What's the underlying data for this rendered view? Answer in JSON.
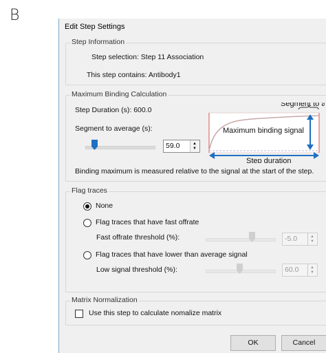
{
  "panel_letter": "B",
  "dialog": {
    "title": "Edit Step Settings",
    "step_info": {
      "legend": "Step Information",
      "selection": "Step selection: Step 11 Association",
      "contains": "This step contains: Antibody1"
    },
    "max_binding": {
      "legend": "Maximum Binding Calculation",
      "duration": "Step Duration (s): 600.0",
      "segment_label": "Segment to average (s):",
      "segment_value": "59.0",
      "segment_slider_fraction": 0.1,
      "note": "Binding maximum is measured relative to the signal at the start of the step.",
      "diagram": {
        "segment_to_average": "Segment to average",
        "max_binding_signal": "Maximum binding signal",
        "step_duration": "Step duration"
      }
    },
    "flag_traces": {
      "legend": "Flag traces",
      "none_label": "None",
      "fast_offrate_label": "Flag traces that have fast offrate",
      "fast_offrate_threshold_label": "Fast offrate threshold (%):",
      "fast_offrate_value": "-5.0",
      "low_signal_label": "Flag traces that have lower than average signal",
      "low_signal_threshold_label": "Low signal threshold (%):",
      "low_signal_value": "60.0",
      "selected": "None"
    },
    "matrix": {
      "legend": "Matrix Normalization",
      "checkbox_label": "Use this step to calculate nomalize matrix",
      "checked": false
    },
    "ok_label": "OK",
    "cancel_label": "Cancel"
  },
  "colors": {
    "accent_blue": "#1f6fc4",
    "signal_red": "#e05050",
    "curve": "#c8a8a8"
  }
}
